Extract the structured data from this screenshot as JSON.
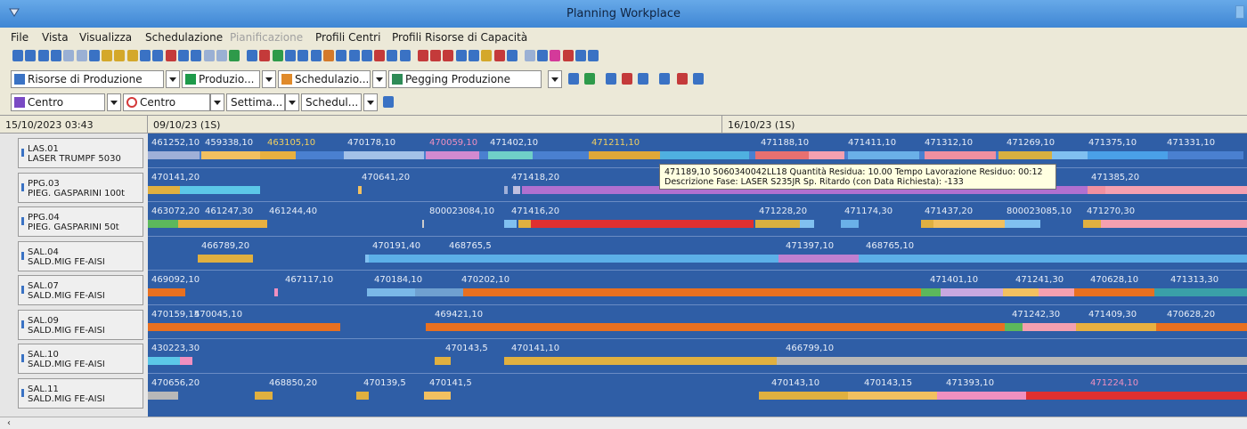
{
  "window": {
    "title": "Planning Workplace"
  },
  "menu": [
    {
      "label": "File",
      "disabled": false
    },
    {
      "label": "Vista",
      "disabled": false
    },
    {
      "label": "Visualizza",
      "disabled": false
    },
    {
      "label": "Schedulazione",
      "disabled": false
    },
    {
      "label": "Pianificazione",
      "disabled": true
    },
    {
      "label": "Profili Centri",
      "disabled": false
    },
    {
      "label": "Profili Risorse di Capacità",
      "disabled": false
    }
  ],
  "toolbar2": {
    "combo1": "Risorse di Produzione",
    "combo2": "Produzio...",
    "combo3": "Schedulazio...",
    "combo4": "Pegging Produzione"
  },
  "toolbar3": {
    "combo1": "Centro",
    "combo2": "Centro",
    "combo3": "Settima...",
    "combo4": "Schedul..."
  },
  "timeline": {
    "current": "15/10/2023 03:43",
    "week1": "09/10/23 (1S)",
    "week2": "16/10/23 (1S)"
  },
  "resources": [
    {
      "code": "LAS.01",
      "name": "LASER TRUMPF 5030"
    },
    {
      "code": "PPG.03",
      "name": "PIEG. GASPARINI 100t"
    },
    {
      "code": "PPG.04",
      "name": "PIEG. GASPARINI 50t"
    },
    {
      "code": "SAL.04",
      "name": "SALD.MIG FE-AISI"
    },
    {
      "code": "SAL.07",
      "name": "SALD.MIG FE-AISI"
    },
    {
      "code": "SAL.09",
      "name": "SALD.MIG FE-AISI"
    },
    {
      "code": "SAL.10",
      "name": "SALD.MIG FE-AISI"
    },
    {
      "code": "SAL.11",
      "name": "SALD.MIG FE-AISI"
    }
  ],
  "gantt_rows": [
    [
      "461252,10",
      "459338,10",
      "463105,10",
      "470178,10",
      "470059,10",
      "471402,10",
      "471211,10",
      "471188,10",
      "471411,10",
      "471312,10",
      "471269,10",
      "471375,10",
      "471331,10"
    ],
    [
      "470141,20",
      "470641,20",
      "471418,20",
      "471385,20"
    ],
    [
      "463072,20",
      "461247,30",
      "461244,40",
      "800023084,10",
      "471416,20",
      "471228,20",
      "471174,30",
      "471437,20",
      "800023085,10",
      "471270,30"
    ],
    [
      "466789,20",
      "470191,40",
      "468765,5",
      "471397,10",
      "468765,10"
    ],
    [
      "469092,10",
      "467117,10",
      "470184,10",
      "470202,10",
      "471401,10",
      "471241,30",
      "470628,10",
      "471313,30"
    ],
    [
      "470159,15",
      "470045,10",
      "469421,10",
      "471242,30",
      "471409,30",
      "470628,20"
    ],
    [
      "430223,30",
      "470143,5",
      "470141,10",
      "466799,10"
    ],
    [
      "470656,20",
      "468850,20",
      "470139,5",
      "470141,5",
      "470143,10",
      "470143,15",
      "471393,10",
      "471224,10"
    ]
  ],
  "tooltip": {
    "line1": "471189,10 5060340042LL18  Quantità Residua: 10.00     Tempo Lavorazione Residuo: 00:12",
    "line2": "Descrizione Fase: LASER S235JR Sp.  Ritardo (con Data Richiesta): -133"
  }
}
